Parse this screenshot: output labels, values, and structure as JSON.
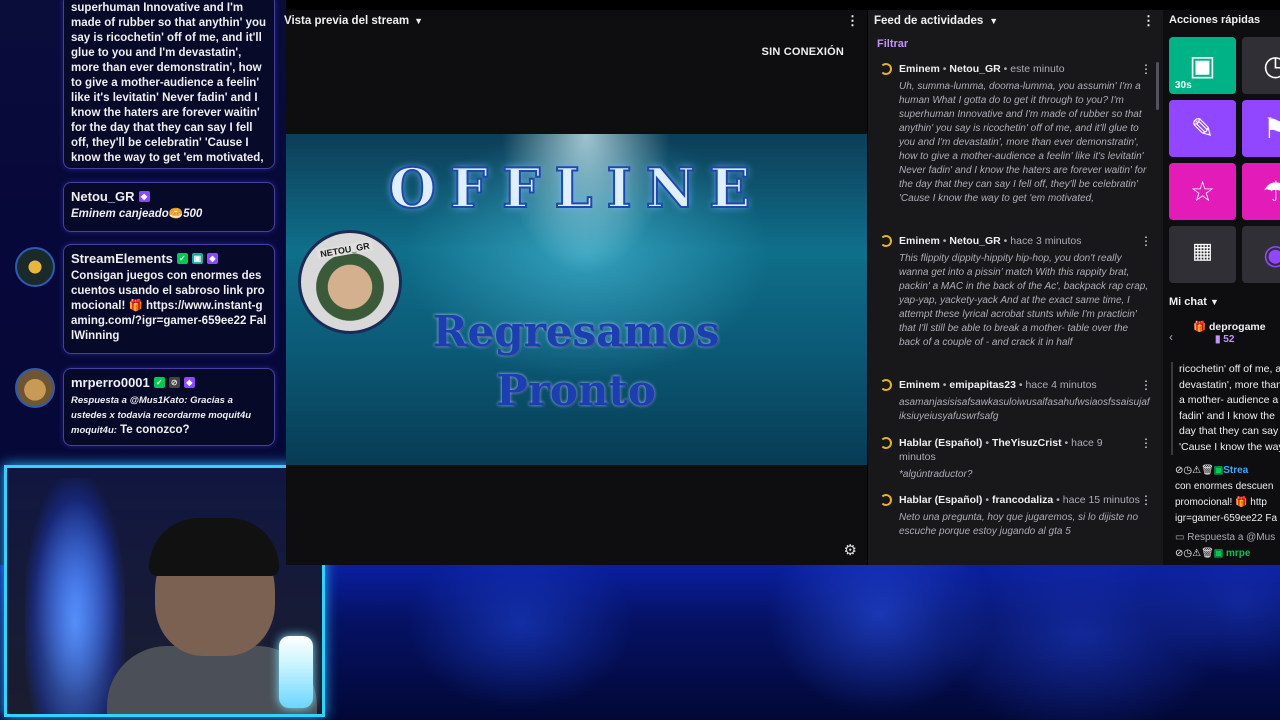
{
  "left_chat": {
    "top_message": "superhuman Innovative and I'm made of rubber so that anythin' you say is ricochetin' off of me, and it'll glue to you and I'm devastatin', more than ever demonstratin', how to give a mother-audience a feelin' like it's levitatin' Never fadin' and I know the haters are forever waitin' for the day that they can say I fell off, they'll be celebratin' 'Cause I know the way to get 'em motivated,",
    "messages": [
      {
        "user": "Netou_GR",
        "text": "Eminem canjeado",
        "points": "500"
      },
      {
        "user": "StreamElements",
        "text": "Consigan juegos con enormes descuentos usando el sabroso link promocional! 🎁 https://www.instant-gaming.com/?igr=gamer-659ee22 FallWinning"
      },
      {
        "user": "mrperro0001",
        "reply": "Respuesta a @Mus1Kato: Gracias a ustedes x todavia recordarme moquit4u moquit4u:",
        "text": "Te conozco?"
      }
    ]
  },
  "preview": {
    "title": "Vista previa del stream",
    "status": "SIN CONEXIÓN",
    "offline_title": "OFFLINE",
    "offline_sub": [
      "Regresamos",
      "Pronto"
    ],
    "logo_tag": "NETOU_GR"
  },
  "feed": {
    "title": "Feed de actividades",
    "filter": "Filtrar",
    "items": [
      {
        "reward": "Eminem",
        "user": "Netou_GR",
        "time": "este minuto",
        "text": "Uh, summa-lumma, dooma-lumma, you assumin' I'm a human What I gotta do to get it through to you? I'm superhuman Innovative and I'm made of rubber so that anythin' you say is ricochetin' off of me, and it'll glue to you and I'm devastatin', more than ever demonstratin', how to give a mother-audience a feelin' like it's levitatin' Never fadin' and I know the haters are forever waitin' for the day that they can say I fell off, they'll be celebratin' 'Cause I know the way to get 'em motivated,"
      },
      {
        "reward": "Eminem",
        "user": "Netou_GR",
        "time": "hace 3 minutos",
        "text": "This flippity dippity-hippity hip-hop, you don't really wanna get into a pissin' match With this rappity brat, packin' a MAC in the back of the Ac', backpack rap crap, yap-yap, yackety-yack And at the exact same time, I attempt these lyrical acrobat stunts while I'm practicin' that I'll still be able to break a mother- table over the back of a couple of - and crack it in half"
      },
      {
        "reward": "Eminem",
        "user": "emipapitas23",
        "time": "hace 4 minutos",
        "text": "asamanjasisisafsawkasuloiwusalfasahufwsiaosfssaisujafiksiuyeiusyafuswrfsafg"
      },
      {
        "reward": "Hablar (Español)",
        "user": "TheYisuzCrist",
        "time": "hace 9 minutos",
        "text": "*algúntraductor?"
      },
      {
        "reward": "Hablar (Español)",
        "user": "francodaliza",
        "time": "hace 15 minutos",
        "text": "Neto una pregunta, hoy que jugaremos, si lo dijiste no escuche porque estoy jugando al gta 5"
      }
    ]
  },
  "quick_actions": {
    "title": "Acciones rápidas",
    "first_label": "30s"
  },
  "my_chat": {
    "title": "Mi chat",
    "pinned_user": "deprogame",
    "pinned_count": "52",
    "lines": [
      "ricochetin' off of me, a",
      "devastatin', more than",
      "a mother- audience a",
      "fadin' and I know the",
      "day that they can say",
      "'Cause I know the way"
    ],
    "se_user": "Strea",
    "se_line1": "con enormes descuen",
    "se_line2": "promocional! 🎁 http",
    "se_line3": "igr=gamer-659ee22 Fa",
    "reply_line": "Respuesta a @Mus",
    "last_user": "mrpe"
  },
  "colors": {
    "accent": "#9147ff",
    "filter": "#bf94ff",
    "webcam_border": "#34d2ff"
  }
}
